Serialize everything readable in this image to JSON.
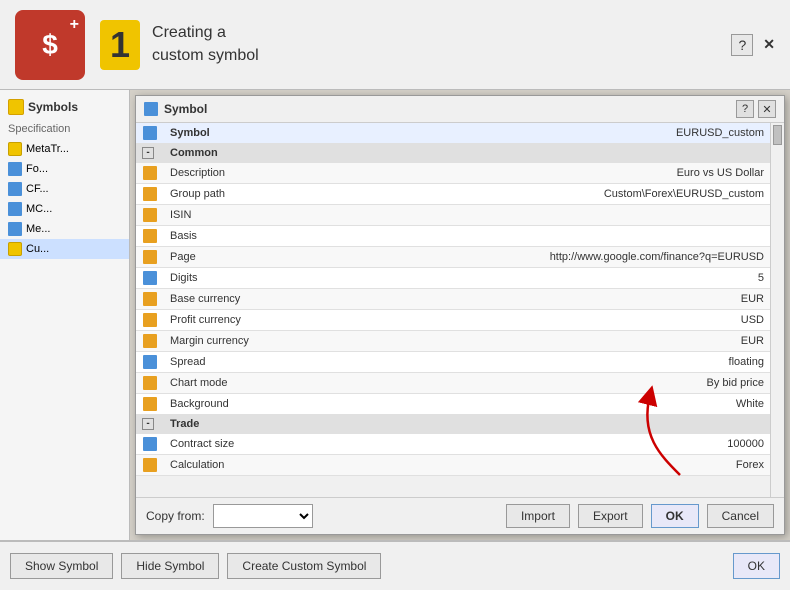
{
  "banner": {
    "icon_symbol": "$+",
    "step_number": "1",
    "step_text_line1": "Creating a",
    "step_text_line2": "custom symbol",
    "help_label": "?",
    "close_label": "✕"
  },
  "left_panel": {
    "header_label": "Symbols",
    "spec_label": "Specification",
    "tree_items": [
      {
        "label": "MetaTr...",
        "type": "folder"
      },
      {
        "label": "Fo...",
        "type": "chart"
      },
      {
        "label": "CF...",
        "type": "chart"
      },
      {
        "label": "MC...",
        "type": "chart"
      },
      {
        "label": "Me...",
        "type": "chart"
      },
      {
        "label": "Cu...",
        "type": "folder",
        "selected": true
      }
    ]
  },
  "dialog": {
    "title": "Symbol",
    "help_btn": "?",
    "close_btn": "✕",
    "symbol_value": "EURUSD_custom",
    "sections": [
      {
        "type": "section",
        "label": "Common"
      },
      {
        "type": "row",
        "icon": "orange",
        "name": "Description",
        "value": "Euro vs US Dollar"
      },
      {
        "type": "row",
        "icon": "orange",
        "name": "Group path",
        "value": "Custom\\Forex\\EURUSD_custom"
      },
      {
        "type": "row",
        "icon": "orange",
        "name": "ISIN",
        "value": ""
      },
      {
        "type": "row",
        "icon": "orange",
        "name": "Basis",
        "value": ""
      },
      {
        "type": "row",
        "icon": "orange",
        "name": "Page",
        "value": "http://www.google.com/finance?q=EURUSD"
      },
      {
        "type": "row",
        "icon": "blue",
        "name": "Digits",
        "value": "5"
      },
      {
        "type": "row",
        "icon": "orange",
        "name": "Base currency",
        "value": "EUR"
      },
      {
        "type": "row",
        "icon": "orange",
        "name": "Profit currency",
        "value": "USD"
      },
      {
        "type": "row",
        "icon": "orange",
        "name": "Margin currency",
        "value": "EUR"
      },
      {
        "type": "row",
        "icon": "blue",
        "name": "Spread",
        "value": "floating"
      },
      {
        "type": "row",
        "icon": "orange",
        "name": "Chart mode",
        "value": "By bid price"
      },
      {
        "type": "row",
        "icon": "orange",
        "name": "Background",
        "value": "White"
      },
      {
        "type": "section",
        "label": "Trade"
      },
      {
        "type": "row",
        "icon": "blue",
        "name": "Contract size",
        "value": "100000"
      },
      {
        "type": "row",
        "icon": "orange",
        "name": "Calculation",
        "value": "Forex"
      }
    ],
    "footer": {
      "copy_from_label": "Copy from:",
      "copy_from_placeholder": "",
      "import_btn": "Import",
      "export_btn": "Export",
      "ok_btn": "OK",
      "cancel_btn": "Cancel"
    }
  },
  "bottom_toolbar": {
    "show_symbol_btn": "Show Symbol",
    "hide_symbol_btn": "Hide Symbol",
    "create_custom_btn": "Create Custom Symbol",
    "ok_btn": "OK"
  }
}
